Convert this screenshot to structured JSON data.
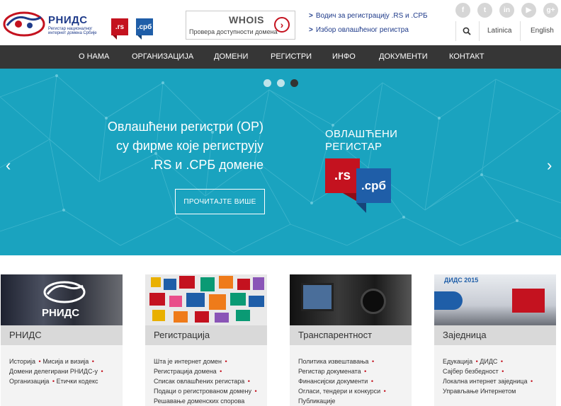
{
  "header": {
    "logo_title": "РНИДС",
    "logo_subtitle": "Регистар националног интернет домена Србије",
    "tld_rs": ".rs",
    "tld_srb": ".срб",
    "whois_title": "WHOIS",
    "whois_subtitle": "Провера доступности домена",
    "quick_links": [
      "Водич за регистрацију .RS и .СРБ",
      "Избор овлашћеног регистра"
    ],
    "social_icons": [
      "facebook-icon",
      "twitter-icon",
      "linkedin-icon",
      "youtube-icon",
      "googleplus-icon"
    ],
    "lang_latin": "Latinica",
    "lang_english": "English"
  },
  "nav": {
    "items": [
      "О НАМА",
      "ОРГАНИЗАЦИЈА",
      "ДОМЕНИ",
      "РЕГИСТРИ",
      "ИНФО",
      "ДОКУМЕНТИ",
      "КОНТАКТ"
    ]
  },
  "hero": {
    "lines": [
      "Овлашћени регистри (ОР)",
      "су фирме које региструју",
      ".RS и .СРБ домене"
    ],
    "cta_label": "ПРОЧИТАЈТЕ ВИШЕ",
    "badge_line1": "ОВЛАШЋЕНИ",
    "badge_line2": "РЕГИСТАР",
    "badge_rs": ".rs",
    "badge_srb": ".срб",
    "slides": 3,
    "active_slide": 3,
    "colors": {
      "background": "#1aa3bf",
      "rs": "#c4121f",
      "srb": "#1f5ea8"
    }
  },
  "cards": [
    {
      "title": "РНИДС",
      "image_label": "РНИДС",
      "links": [
        "Историја",
        "Мисија и визија",
        "Домени делегирани РНИДС-у",
        "Организација",
        "Етички кодекс"
      ]
    },
    {
      "title": "Регистрација",
      "links": [
        "Шта је интернет домен",
        "Регистрација домена",
        "Списак овлашћених регистара",
        "Подаци о регистрованом домену",
        "Решавање доменских спорова"
      ]
    },
    {
      "title": "Транспарентност",
      "links": [
        "Политика извештавања",
        "Регистар докумената",
        "Финансијски документи",
        "Огласи, тендери и конкурси",
        "Публикације"
      ]
    },
    {
      "title": "Заједница",
      "image_label": "ДИДС 2015",
      "links": [
        "Едукација",
        "ДИДС",
        "Сајбер безбедност",
        "Локална интернет заједница",
        "Управљање Интернетом"
      ]
    }
  ]
}
